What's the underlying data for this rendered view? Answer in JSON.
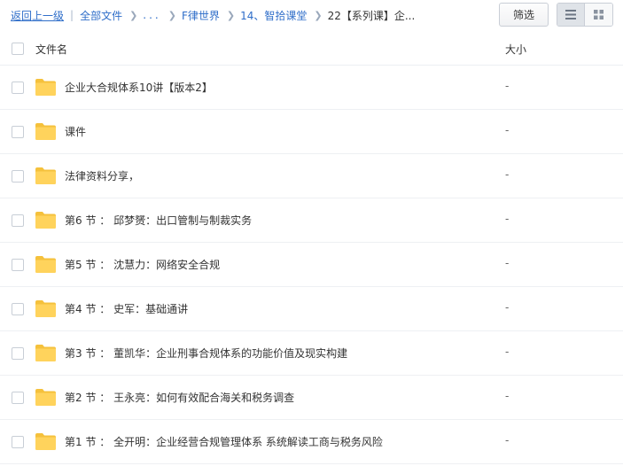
{
  "breadcrumb": {
    "back": "返回上一级",
    "all_files": "全部文件",
    "ellipsis": "...",
    "crumb1": "F律世界",
    "crumb2": "14、智拾课堂",
    "current": "22【系列课】企..."
  },
  "toolbar": {
    "filter_label": "筛选"
  },
  "columns": {
    "name": "文件名",
    "size": "大小"
  },
  "files": [
    {
      "name": "企业大合规体系10讲【版本2】",
      "size": "-"
    },
    {
      "name": "课件",
      "size": "-"
    },
    {
      "name": "法律资料分享，",
      "size": "-"
    },
    {
      "name": "第6 节 ： 邱梦赟：出口管制与制裁实务",
      "size": "-"
    },
    {
      "name": "第5 节 ： 沈慧力：网络安全合规",
      "size": "-"
    },
    {
      "name": "第4 节 ： 史军：基础通讲",
      "size": "-"
    },
    {
      "name": "第3 节 ： 董凯华：企业刑事合规体系的功能价值及现实构建",
      "size": "-"
    },
    {
      "name": "第2 节 ： 王永亮：如何有效配合海关和税务调查",
      "size": "-"
    },
    {
      "name": "第1 节 ： 全开明：企业经营合规管理体系 系统解读工商与税务风险",
      "size": "-"
    }
  ],
  "colors": {
    "link": "#2f6ec9",
    "folder": "#ffd35c",
    "folder_tab": "#f5c13c"
  }
}
